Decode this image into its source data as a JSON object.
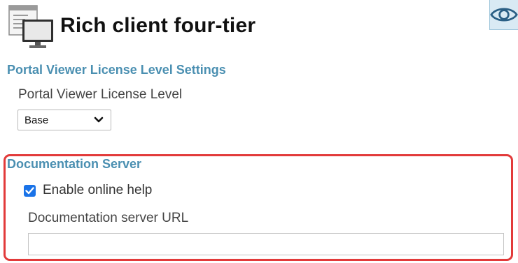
{
  "header": {
    "title": "Rich client four-tier",
    "icon": "client-computer-icon",
    "view_icon": "eye-icon"
  },
  "license_section": {
    "heading": "Portal Viewer License Level Settings",
    "field_label": "Portal Viewer License Level",
    "selected_value": "Base"
  },
  "documentation_section": {
    "heading": "Documentation Server",
    "enable_help_label": "Enable online help",
    "enable_help_checked": true,
    "url_label": "Documentation server URL",
    "url_value": ""
  },
  "colors": {
    "heading_blue": "#4a8fb1",
    "highlight_red": "#e23a3a",
    "checkbox_blue": "#1a73e8"
  }
}
